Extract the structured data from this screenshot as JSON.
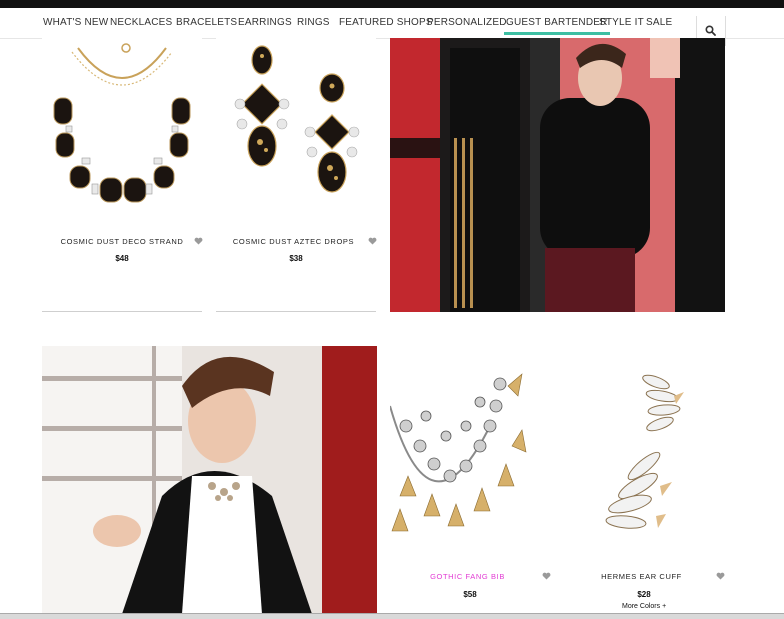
{
  "nav": {
    "items": [
      {
        "label": "WHAT'S NEW"
      },
      {
        "label": "NECKLACES"
      },
      {
        "label": "BRACELETS"
      },
      {
        "label": "EARRINGS"
      },
      {
        "label": "RINGS"
      },
      {
        "label": "FEATURED SHOPS"
      },
      {
        "label": "PERSONALIZED"
      },
      {
        "label": "GUEST BARTENDER"
      },
      {
        "label": "STYLE IT"
      },
      {
        "label": "SALE"
      }
    ],
    "active": "GUEST BARTENDER",
    "search_icon": "search-icon"
  },
  "products": [
    {
      "name": "COSMIC DUST DECO STRAND",
      "price": "$48"
    },
    {
      "name": "COSMIC DUST AZTEC DROPS",
      "price": "$38"
    },
    {
      "name": "GOTHIC FANG BIB",
      "price": "$58"
    },
    {
      "name": "HERMES EAR CUFF",
      "price": "$28",
      "more_colors": "More Colors +"
    }
  ],
  "colors": {
    "accent": "#3dbfa3",
    "highlight_name": "#e23bd3",
    "heart": "#9a9a9a"
  }
}
